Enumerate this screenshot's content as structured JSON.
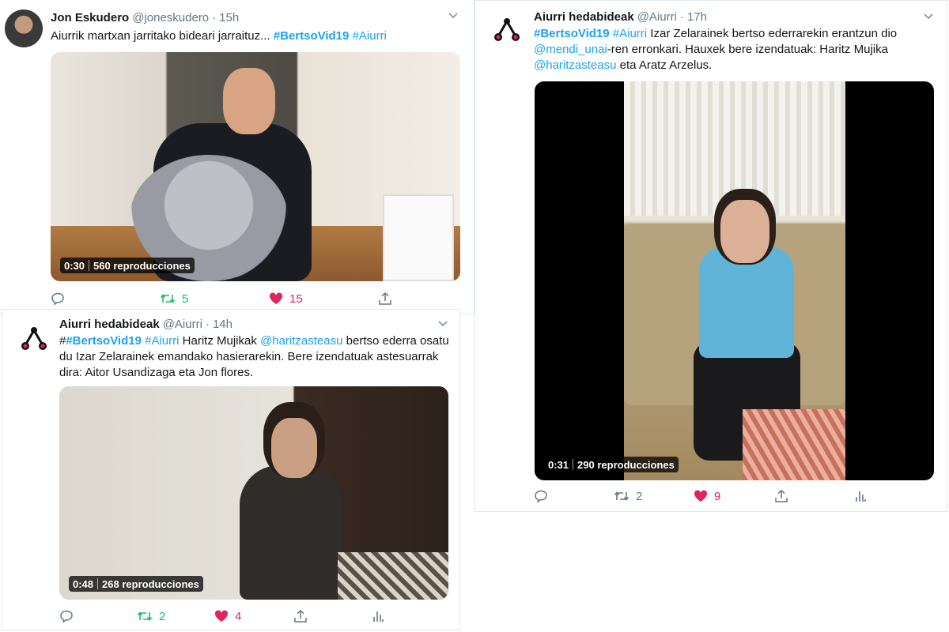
{
  "tweets": [
    {
      "name": "Jon Eskudero",
      "handle": "@joneskudero",
      "dot": "·",
      "time": "15h",
      "text_plain": "Aiurrik martxan jarritako bideari jarraituz... ",
      "hashtag1": "#BertsoVid19",
      "hashtag2": "#Aiurri",
      "video": {
        "duration": "0:30",
        "views": "560 reproducciones"
      },
      "actions": {
        "retweets": "5",
        "likes": "15"
      }
    },
    {
      "name": "Aiurri hedabideak",
      "handle": "@Aiurri",
      "dot": "·",
      "time": "14h",
      "text_prefix": "#",
      "hashtag1": "#BertsoVid19",
      "hashtag2": "#Aiurri",
      "text_mid": " Haritz Mujikak ",
      "mention": "@haritzasteasu",
      "text_end": " bertso ederra osatu du Izar Zelarainek emandako hasierarekin. Bere izendatuak astesuarrak dira: Aitor Usandizaga eta Jon flores.",
      "video": {
        "duration": "0:48",
        "views": "268 reproducciones"
      },
      "actions": {
        "retweets": "2",
        "likes": "4"
      }
    },
    {
      "name": "Aiurri hedabideak",
      "handle": "@Aiurri",
      "dot": "·",
      "time": "17h",
      "hashtag1": "#BertsoVid19",
      "hashtag2": "#Aiurri",
      "text_a": " Izar Zelarainek bertso ederrarekin erantzun dio ",
      "mention1": "@mendi_unai",
      "text_b": "-ren erronkari. Hauxek bere izendatuak: Haritz Mujika ",
      "mention2": "@haritzasteasu",
      "text_c": " eta Aratz Arzelus.",
      "video": {
        "duration": "0:31",
        "views": "290 reproducciones"
      },
      "actions": {
        "retweets": "2",
        "likes": "9"
      }
    }
  ],
  "icons": {
    "reply": "reply-icon",
    "retweet": "retweet-icon",
    "like": "heart-icon",
    "share": "share-icon",
    "analytics": "analytics-icon",
    "chevron": "chevron-down-icon"
  },
  "colors": {
    "link": "#1da1f2",
    "retweet_active": "#17bf63",
    "like": "#e0245e",
    "muted": "#657786"
  }
}
